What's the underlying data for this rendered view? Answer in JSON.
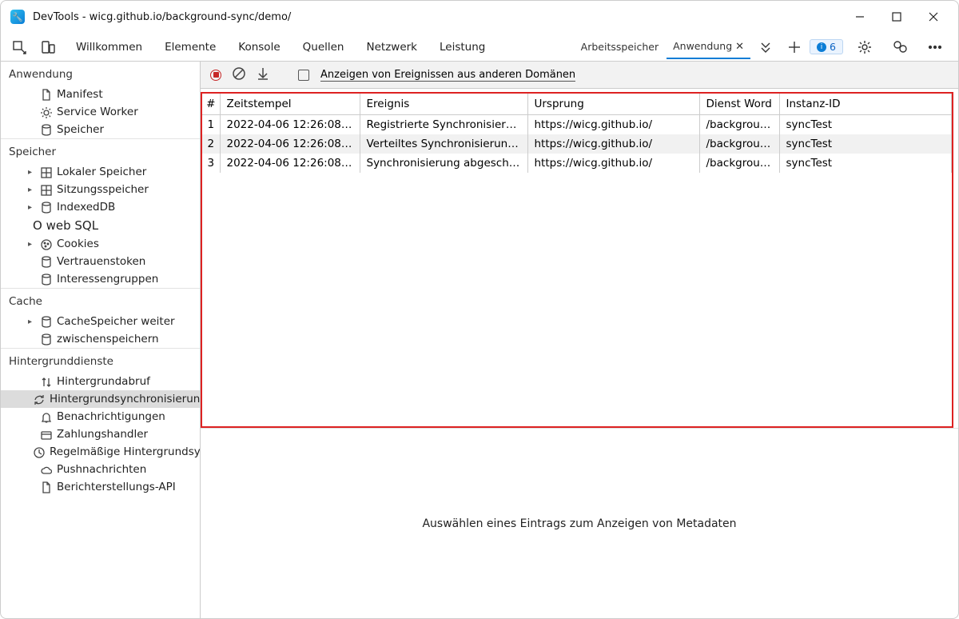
{
  "window": {
    "title": "DevTools - wicg.github.io/background-sync/demo/"
  },
  "tabs": {
    "main": [
      "Willkommen",
      "Elemente",
      "Konsole",
      "Quellen",
      "Netzwerk",
      "Leistung"
    ],
    "aux": [
      "Arbeitsspeicher",
      "Anwendung"
    ],
    "aux_active": "Anwendung"
  },
  "badge_count": "6",
  "sidebar": {
    "app_h": "Anwendung",
    "app": [
      {
        "icon": "file",
        "label": "Manifest"
      },
      {
        "icon": "gear",
        "label": "Service Worker"
      },
      {
        "icon": "db",
        "label": "Speicher"
      }
    ],
    "storage_h": "Speicher",
    "storage": [
      {
        "icon": "grid",
        "label": "Lokaler Speicher",
        "exp": true
      },
      {
        "icon": "grid",
        "label": "Sitzungsspeicher",
        "exp": true
      },
      {
        "icon": "db",
        "label": "IndexedDB",
        "exp": true
      },
      {
        "icon": "websql",
        "label": "O web SQL"
      },
      {
        "icon": "cookie",
        "label": "Cookies",
        "exp": true
      },
      {
        "icon": "db",
        "label": "Vertrauenstoken"
      },
      {
        "icon": "db",
        "label": "Interessengruppen"
      }
    ],
    "cache_h": "Cache",
    "cache": [
      {
        "icon": "db",
        "label": "CacheSpeicher weiter",
        "exp": true
      },
      {
        "icon": "db",
        "label": "zwischenspeichern"
      }
    ],
    "bg_h": "Hintergrunddienste",
    "bg": [
      {
        "icon": "updown",
        "label": "Hintergrundabruf"
      },
      {
        "icon": "sync",
        "label": "Hintergrundsynchronisierung",
        "selected": true
      },
      {
        "icon": "bell",
        "label": "Benachrichtigungen"
      },
      {
        "icon": "card",
        "label": "Zahlungshandler"
      },
      {
        "icon": "clock",
        "label": "Regelmäßige Hintergrundsynchronisierung"
      },
      {
        "icon": "cloud",
        "label": "Pushnachrichten"
      },
      {
        "icon": "file",
        "label": "Berichterstellungs-API"
      }
    ]
  },
  "ctrl": {
    "checkbox_label": "Anzeigen von Ereignissen aus anderen Domänen"
  },
  "table": {
    "headers": {
      "n": "#",
      "ts": "Zeitstempel",
      "ev": "Ereignis",
      "or": "Ursprung",
      "sw": "Dienst Word",
      "id": "Instanz-ID"
    },
    "rows": [
      {
        "n": "1",
        "ts": "2022-04-06 12:26:08.0...",
        "ev": "Registrierte Synchronisierung",
        "or": "https://wicg.github.io/",
        "sw": "/backgroun...",
        "id": "syncTest"
      },
      {
        "n": "2",
        "ts": "2022-04-06 12:26:08.0...",
        "ev": "Verteiltes Synchronisierungsereignis",
        "or": "https://wicg.github.io/",
        "sw": "/backgroun...",
        "id": "syncTest"
      },
      {
        "n": "3",
        "ts": "2022-04-06 12:26:08.0...",
        "ev": "Synchronisierung abgeschlossen",
        "or": "https://wicg.github.io/",
        "sw": "/backgroun...",
        "id": "syncTest"
      }
    ]
  },
  "detail_placeholder": "Auswählen eines Eintrags zum Anzeigen von Metadaten"
}
